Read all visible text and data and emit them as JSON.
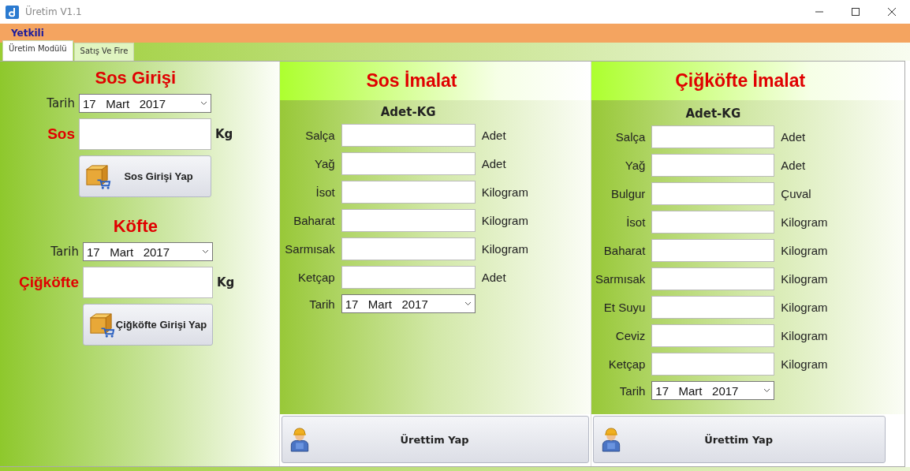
{
  "window": {
    "title": "Üretim V1.1"
  },
  "menu": [
    {
      "label": "Yetkili"
    }
  ],
  "tabs": [
    {
      "label": "Üretim Modülü",
      "selected": true
    },
    {
      "label": "Satış Ve Fire",
      "selected": false
    }
  ],
  "entry_sections": [
    {
      "title": "Sos Girişi",
      "date_label": "Tarih",
      "date": "17   Mart   2017",
      "item_label": "Sos",
      "unit": "Kg",
      "button": "Sos Girişi Yap"
    },
    {
      "title": "Köfte",
      "date_label": "Tarih",
      "date": "17   Mart   2017",
      "item_label": "Çiğköfte",
      "unit": "Kg",
      "button": "Çiğköfte Girişi Yap"
    }
  ],
  "production_panels": [
    {
      "title": "Sos İmalat",
      "subtitle": "Adet-KG",
      "rows": [
        {
          "label": "Salça",
          "unit": "Adet"
        },
        {
          "label": "Yağ",
          "unit": "Adet"
        },
        {
          "label": "İsot",
          "unit": "Kilogram"
        },
        {
          "label": "Baharat",
          "unit": "Kilogram"
        },
        {
          "label": "Sarmısak",
          "unit": "Kilogram"
        },
        {
          "label": "Ketçap",
          "unit": "Adet"
        }
      ],
      "date_label": "Tarih",
      "date": "17   Mart   2017",
      "button": "Ürettim Yap"
    },
    {
      "title": "Çiğköfte İmalat",
      "subtitle": "Adet-KG",
      "rows": [
        {
          "label": "Salça",
          "unit": "Adet"
        },
        {
          "label": "Yağ",
          "unit": "Adet"
        },
        {
          "label": "Bulgur",
          "unit": "Çuval"
        },
        {
          "label": "İsot",
          "unit": "Kilogram"
        },
        {
          "label": "Baharat",
          "unit": "Kilogram"
        },
        {
          "label": "Sarmısak",
          "unit": "Kilogram"
        },
        {
          "label": "Et Suyu",
          "unit": "Kilogram"
        },
        {
          "label": "Ceviz",
          "unit": "Kilogram"
        },
        {
          "label": "Ketçap",
          "unit": "Kilogram"
        }
      ],
      "date_label": "Tarih",
      "date": "17   Mart   2017",
      "button": "Ürettim Yap"
    }
  ]
}
